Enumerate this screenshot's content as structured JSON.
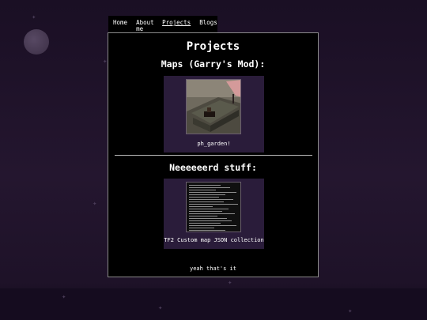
{
  "nav": {
    "items": [
      {
        "label": "Home"
      },
      {
        "label": "About me"
      },
      {
        "label": "Projects"
      },
      {
        "label": "Blogs"
      }
    ]
  },
  "page": {
    "title": "Projects",
    "sections": [
      {
        "heading": "Maps (Garry's Mod):",
        "cards": [
          {
            "label": "ph_garden!"
          }
        ]
      },
      {
        "heading": "Neeeeeerd stuff:",
        "cards": [
          {
            "label": "TF2 Custom map JSON collection"
          }
        ]
      }
    ],
    "footer_note": "yeah that's it"
  },
  "colors": {
    "background": "#1e1228",
    "panel": "#000000",
    "card": "#2a1c3a",
    "text": "#ffffff"
  }
}
